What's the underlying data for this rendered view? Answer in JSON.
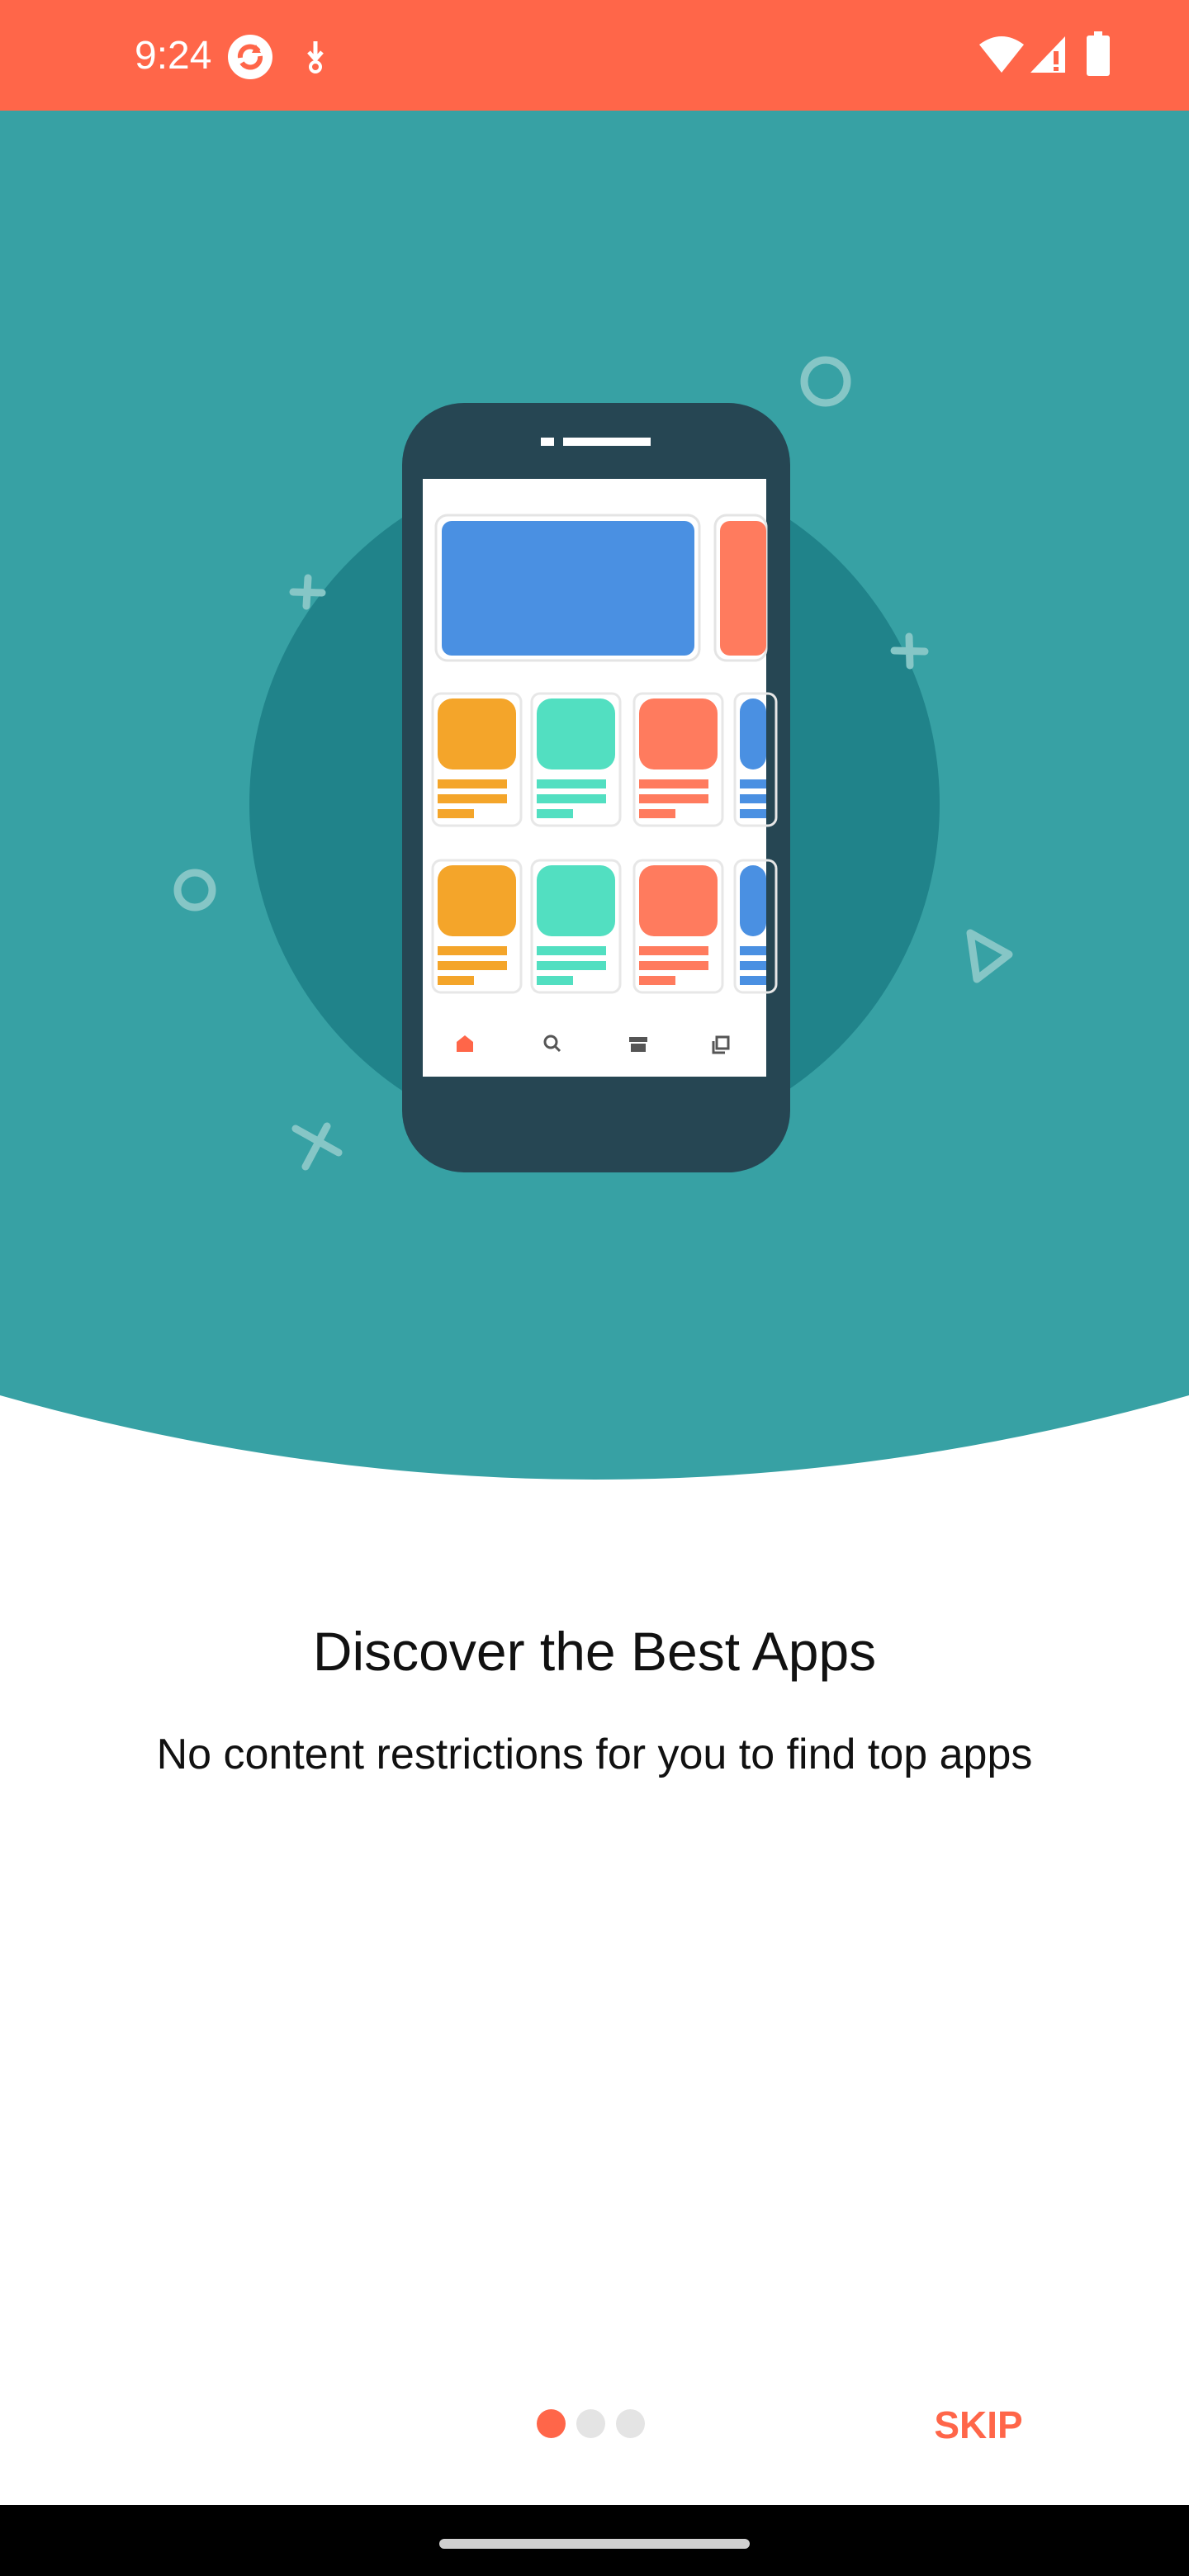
{
  "status_bar": {
    "time": "9:24",
    "left_icons": [
      "sync-app-icon",
      "download-notification-icon"
    ],
    "right_icons": [
      "wifi-icon",
      "cellular-signal-icon",
      "battery-icon"
    ],
    "background_color": "#FF6649"
  },
  "hero": {
    "background_color": "#37A1A4",
    "circle_color": "#20838A",
    "phone_color": "#264653",
    "illustration_nav_icons": [
      "home-icon",
      "search-icon",
      "store-icon",
      "library-icon"
    ]
  },
  "onboarding": {
    "title": "Discover the Best Apps",
    "subtitle": "No content restrictions for you to find top apps",
    "page_count": 3,
    "current_page": 1
  },
  "actions": {
    "skip_label": "SKIP"
  },
  "colors": {
    "accent": "#FF6649",
    "dot_inactive": "#E4E4E4"
  }
}
